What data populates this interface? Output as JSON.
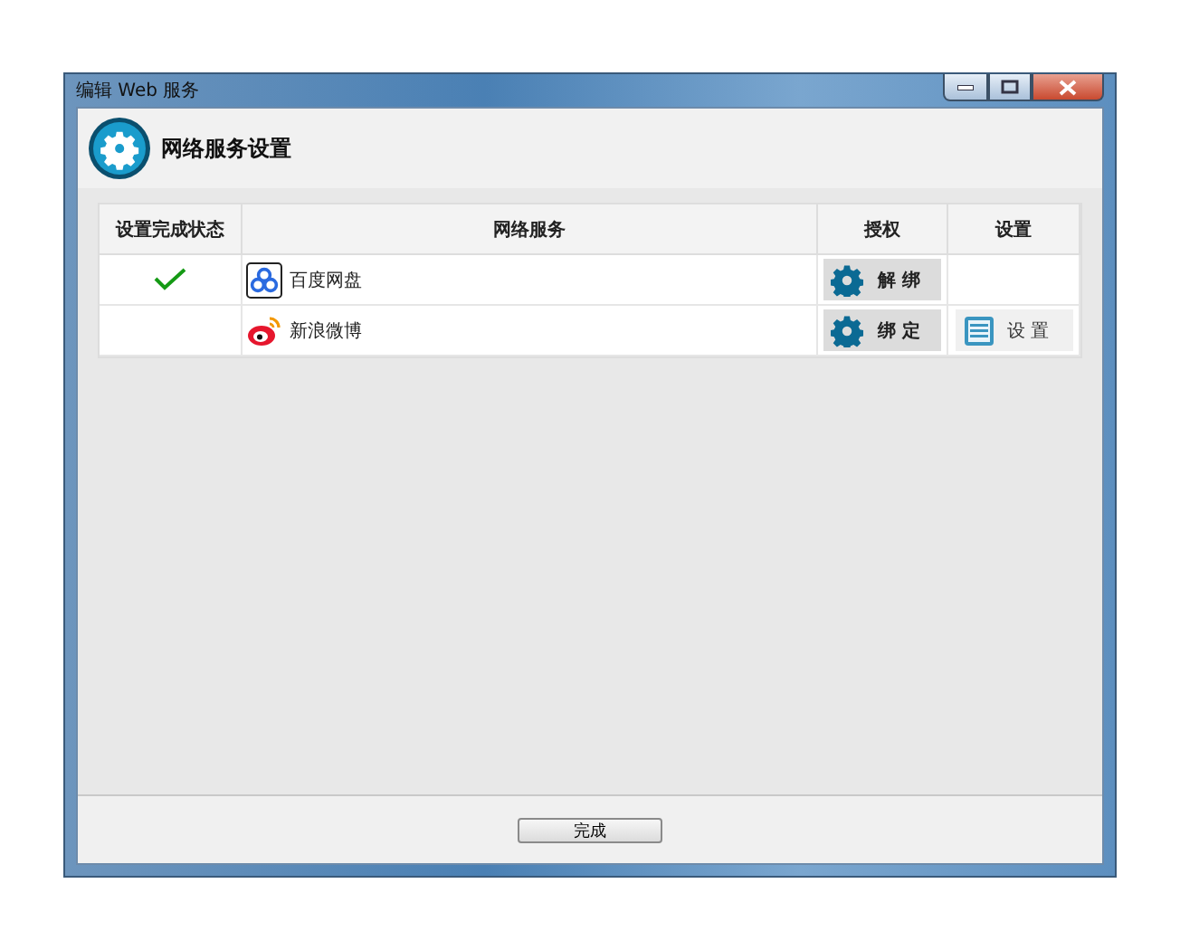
{
  "window": {
    "title": "编辑 Web 服务"
  },
  "header": {
    "title": "网络服务设置"
  },
  "table": {
    "columns": [
      "设置完成状态",
      "网络服务",
      "授权",
      "设置"
    ],
    "rows": [
      {
        "done": true,
        "service": {
          "kind": "baidu",
          "name": "百度网盘"
        },
        "auth_button": "解 绑",
        "settings_button": null
      },
      {
        "done": false,
        "service": {
          "kind": "weibo",
          "name": "新浪微博"
        },
        "auth_button": "绑 定",
        "settings_button": "设 置"
      }
    ]
  },
  "footer": {
    "button": "完成"
  }
}
